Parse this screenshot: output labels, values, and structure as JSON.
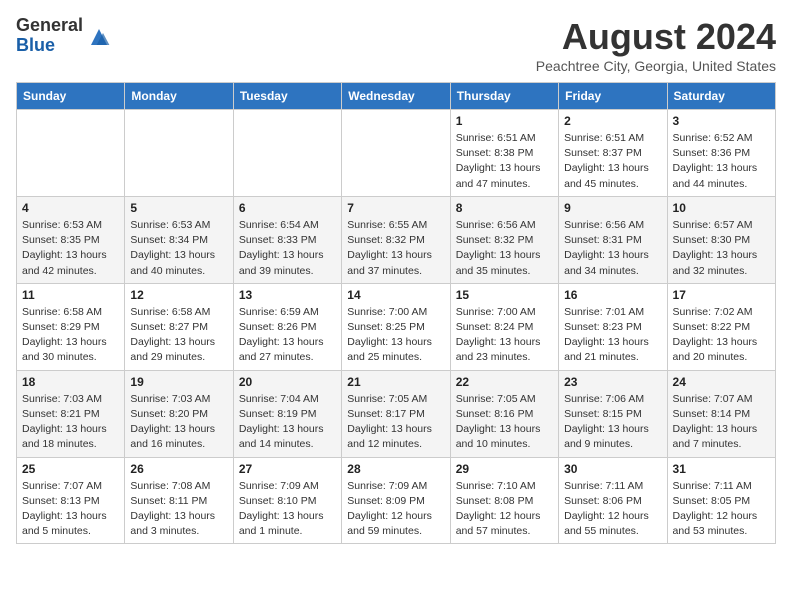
{
  "logo": {
    "general": "General",
    "blue": "Blue"
  },
  "header": {
    "month": "August 2024",
    "location": "Peachtree City, Georgia, United States"
  },
  "days_of_week": [
    "Sunday",
    "Monday",
    "Tuesday",
    "Wednesday",
    "Thursday",
    "Friday",
    "Saturday"
  ],
  "weeks": [
    [
      {
        "day": "",
        "info": ""
      },
      {
        "day": "",
        "info": ""
      },
      {
        "day": "",
        "info": ""
      },
      {
        "day": "",
        "info": ""
      },
      {
        "day": "1",
        "info": "Sunrise: 6:51 AM\nSunset: 8:38 PM\nDaylight: 13 hours and 47 minutes."
      },
      {
        "day": "2",
        "info": "Sunrise: 6:51 AM\nSunset: 8:37 PM\nDaylight: 13 hours and 45 minutes."
      },
      {
        "day": "3",
        "info": "Sunrise: 6:52 AM\nSunset: 8:36 PM\nDaylight: 13 hours and 44 minutes."
      }
    ],
    [
      {
        "day": "4",
        "info": "Sunrise: 6:53 AM\nSunset: 8:35 PM\nDaylight: 13 hours and 42 minutes."
      },
      {
        "day": "5",
        "info": "Sunrise: 6:53 AM\nSunset: 8:34 PM\nDaylight: 13 hours and 40 minutes."
      },
      {
        "day": "6",
        "info": "Sunrise: 6:54 AM\nSunset: 8:33 PM\nDaylight: 13 hours and 39 minutes."
      },
      {
        "day": "7",
        "info": "Sunrise: 6:55 AM\nSunset: 8:32 PM\nDaylight: 13 hours and 37 minutes."
      },
      {
        "day": "8",
        "info": "Sunrise: 6:56 AM\nSunset: 8:32 PM\nDaylight: 13 hours and 35 minutes."
      },
      {
        "day": "9",
        "info": "Sunrise: 6:56 AM\nSunset: 8:31 PM\nDaylight: 13 hours and 34 minutes."
      },
      {
        "day": "10",
        "info": "Sunrise: 6:57 AM\nSunset: 8:30 PM\nDaylight: 13 hours and 32 minutes."
      }
    ],
    [
      {
        "day": "11",
        "info": "Sunrise: 6:58 AM\nSunset: 8:29 PM\nDaylight: 13 hours and 30 minutes."
      },
      {
        "day": "12",
        "info": "Sunrise: 6:58 AM\nSunset: 8:27 PM\nDaylight: 13 hours and 29 minutes."
      },
      {
        "day": "13",
        "info": "Sunrise: 6:59 AM\nSunset: 8:26 PM\nDaylight: 13 hours and 27 minutes."
      },
      {
        "day": "14",
        "info": "Sunrise: 7:00 AM\nSunset: 8:25 PM\nDaylight: 13 hours and 25 minutes."
      },
      {
        "day": "15",
        "info": "Sunrise: 7:00 AM\nSunset: 8:24 PM\nDaylight: 13 hours and 23 minutes."
      },
      {
        "day": "16",
        "info": "Sunrise: 7:01 AM\nSunset: 8:23 PM\nDaylight: 13 hours and 21 minutes."
      },
      {
        "day": "17",
        "info": "Sunrise: 7:02 AM\nSunset: 8:22 PM\nDaylight: 13 hours and 20 minutes."
      }
    ],
    [
      {
        "day": "18",
        "info": "Sunrise: 7:03 AM\nSunset: 8:21 PM\nDaylight: 13 hours and 18 minutes."
      },
      {
        "day": "19",
        "info": "Sunrise: 7:03 AM\nSunset: 8:20 PM\nDaylight: 13 hours and 16 minutes."
      },
      {
        "day": "20",
        "info": "Sunrise: 7:04 AM\nSunset: 8:19 PM\nDaylight: 13 hours and 14 minutes."
      },
      {
        "day": "21",
        "info": "Sunrise: 7:05 AM\nSunset: 8:17 PM\nDaylight: 13 hours and 12 minutes."
      },
      {
        "day": "22",
        "info": "Sunrise: 7:05 AM\nSunset: 8:16 PM\nDaylight: 13 hours and 10 minutes."
      },
      {
        "day": "23",
        "info": "Sunrise: 7:06 AM\nSunset: 8:15 PM\nDaylight: 13 hours and 9 minutes."
      },
      {
        "day": "24",
        "info": "Sunrise: 7:07 AM\nSunset: 8:14 PM\nDaylight: 13 hours and 7 minutes."
      }
    ],
    [
      {
        "day": "25",
        "info": "Sunrise: 7:07 AM\nSunset: 8:13 PM\nDaylight: 13 hours and 5 minutes."
      },
      {
        "day": "26",
        "info": "Sunrise: 7:08 AM\nSunset: 8:11 PM\nDaylight: 13 hours and 3 minutes."
      },
      {
        "day": "27",
        "info": "Sunrise: 7:09 AM\nSunset: 8:10 PM\nDaylight: 13 hours and 1 minute."
      },
      {
        "day": "28",
        "info": "Sunrise: 7:09 AM\nSunset: 8:09 PM\nDaylight: 12 hours and 59 minutes."
      },
      {
        "day": "29",
        "info": "Sunrise: 7:10 AM\nSunset: 8:08 PM\nDaylight: 12 hours and 57 minutes."
      },
      {
        "day": "30",
        "info": "Sunrise: 7:11 AM\nSunset: 8:06 PM\nDaylight: 12 hours and 55 minutes."
      },
      {
        "day": "31",
        "info": "Sunrise: 7:11 AM\nSunset: 8:05 PM\nDaylight: 12 hours and 53 minutes."
      }
    ]
  ]
}
